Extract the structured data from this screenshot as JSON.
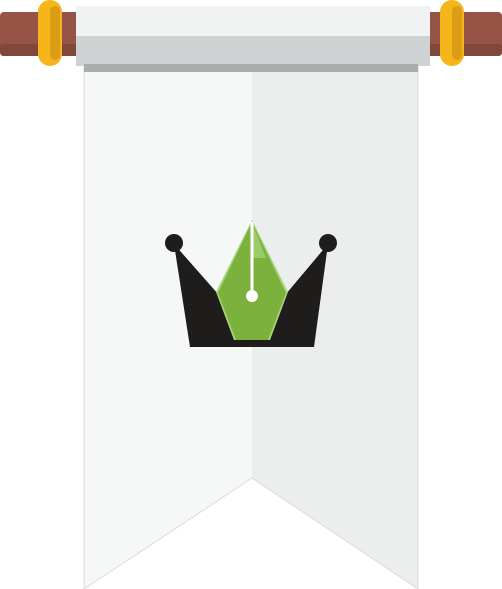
{
  "image": {
    "subject": "pennant-banner",
    "icon": "crown-with-pen-nib-icon"
  },
  "colors": {
    "background": "#ffffff",
    "banner_left": "#f6f7f7",
    "banner_right": "#eceeee",
    "banner_outline": "#d8dcdc",
    "roller_top": "#f1f3f3",
    "roller_bottom": "#cfd2d2",
    "roller_shadow": "#a9adad",
    "rod_wood": "#955445",
    "rod_wood_dark": "#6f3c31",
    "rod_cap": "#f5b51b",
    "rod_cap_shadow": "#cc9012",
    "crown": "#1f1c1c",
    "nib_green": "#7bb13c",
    "nib_green_light": "#a9d47a",
    "nib_line": "#ffffff"
  }
}
